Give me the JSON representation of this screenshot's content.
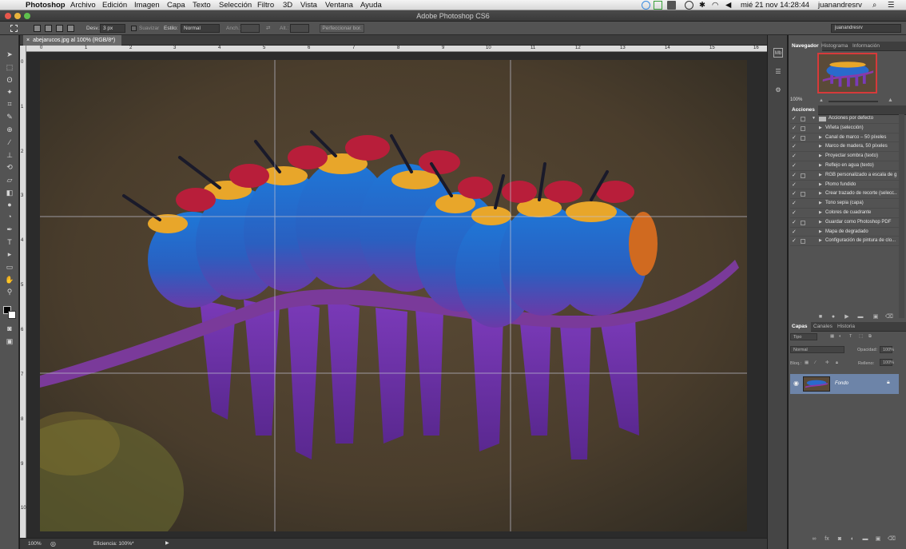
{
  "menubar": {
    "app": "Photoshop",
    "items": [
      "Archivo",
      "Edición",
      "Imagen",
      "Capa",
      "Texto",
      "Selección",
      "Filtro",
      "3D",
      "Vista",
      "Ventana",
      "Ayuda"
    ],
    "clock": "mié 21 nov  14:28:44",
    "user": "juanandresrv"
  },
  "titlebar": {
    "title": "Adobe Photoshop CS6"
  },
  "options": {
    "feather_label": "Desv.:",
    "feather_value": "3 px",
    "smooth_label": "Suavizar",
    "style_label": "Estilo:",
    "style_value": "Normal",
    "width_label": "Anch.:",
    "height_label": "Alt.:",
    "refine_label": "Perfeccionar bor.",
    "workspace": "juanandresrv"
  },
  "document": {
    "tab": "abejarucos.jpg al 100% (RGB/8*)",
    "ruler_h": [
      "0",
      "1",
      "2",
      "3",
      "4",
      "5",
      "6",
      "7",
      "8",
      "9",
      "10",
      "11",
      "12",
      "13",
      "14",
      "15",
      "16"
    ],
    "ruler_v": [
      "0",
      "1",
      "2",
      "3",
      "4",
      "5",
      "6",
      "7",
      "8",
      "9",
      "10"
    ],
    "zoom": "100%",
    "efficiency": "Eficiencia: 100%*"
  },
  "panels": {
    "nav_tabs": [
      "Navegador",
      "Histograma",
      "Información"
    ],
    "nav_zoom": "100%",
    "actions_title": "Acciones",
    "action_set": "Acciones por defecto",
    "actions": [
      "Viñeta (selección)",
      "Canal de marco – 50 píxeles",
      "Marco de madera, 50 píxeles",
      "Proyectar sombra (texto)",
      "Reflejo en agua (texto)",
      "RGB personalizado a escala de g...",
      "Plomo fundido",
      "Crear trazado de recorte (selecc...",
      "Tono sepia (capa)",
      "Colores de cuadrante",
      "Guardar como Photoshop PDF",
      "Mapa de degradado",
      "Configuración de pintura de clo..."
    ],
    "layer_tabs": [
      "Capas",
      "Canales",
      "Historia"
    ],
    "kind": "Tipo",
    "blend": "Normal",
    "opacity_label": "Opacidad:",
    "opacity_value": "100%",
    "lock_label": "Bloq.:",
    "fill_label": "Relleno:",
    "fill_value": "100%",
    "layer_name": "Fondo"
  },
  "colors": {
    "ui_dark": "#535353",
    "accent_thumb_border": "#d63a3a",
    "layer_selected": "#6d84a8"
  }
}
